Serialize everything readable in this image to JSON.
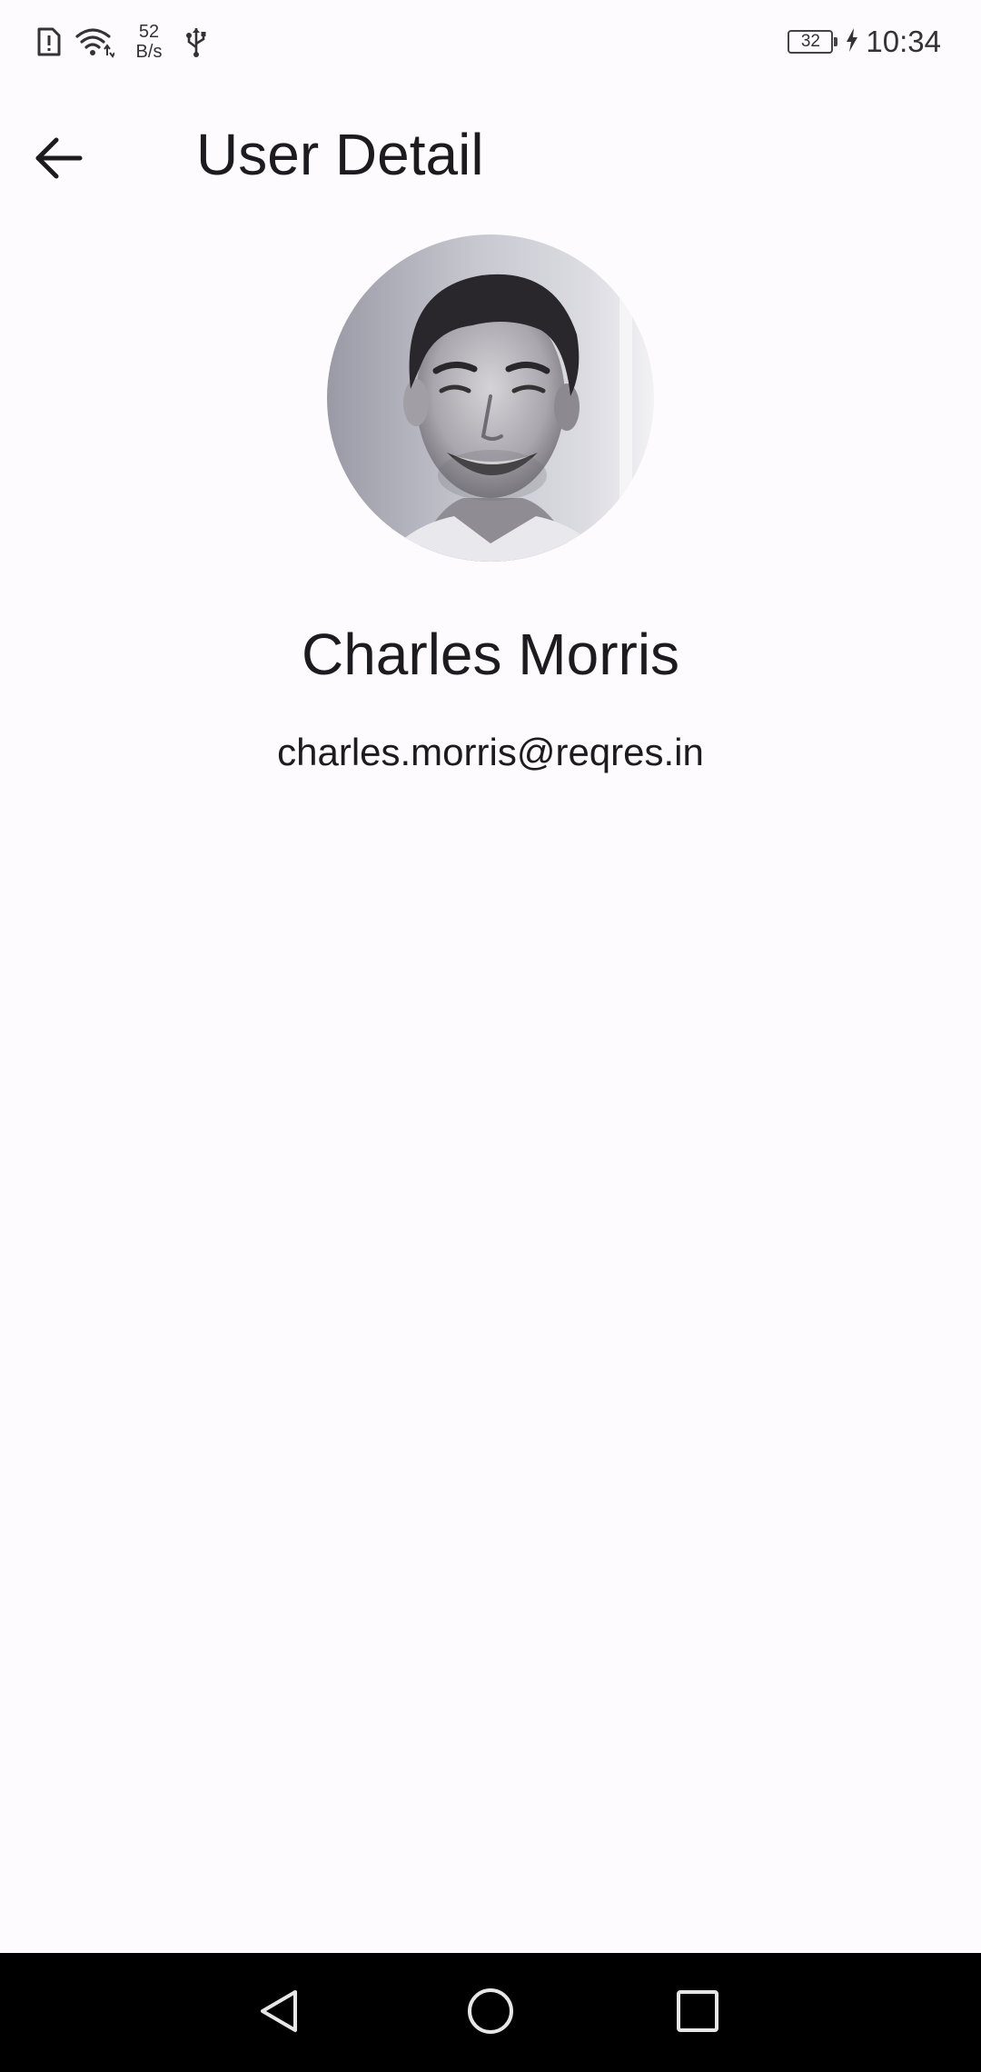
{
  "status_bar": {
    "net_speed_value": "52",
    "net_speed_unit": "B/s",
    "battery_level": "32",
    "time": "10:34",
    "icons": [
      "sim-alert-icon",
      "wifi-icon",
      "usb-icon",
      "charging-icon"
    ]
  },
  "app_bar": {
    "title": "User Detail",
    "back_icon": "arrow-back-icon"
  },
  "user": {
    "name": "Charles Morris",
    "email": "charles.morris@reqres.in",
    "avatar_icon": "avatar-photo"
  },
  "nav_bar": {
    "icons": [
      "nav-back-icon",
      "nav-home-icon",
      "nav-recents-icon"
    ]
  },
  "colors": {
    "background": "#fefbfe",
    "text": "#1c1b1f",
    "nav_bar": "#000000"
  }
}
